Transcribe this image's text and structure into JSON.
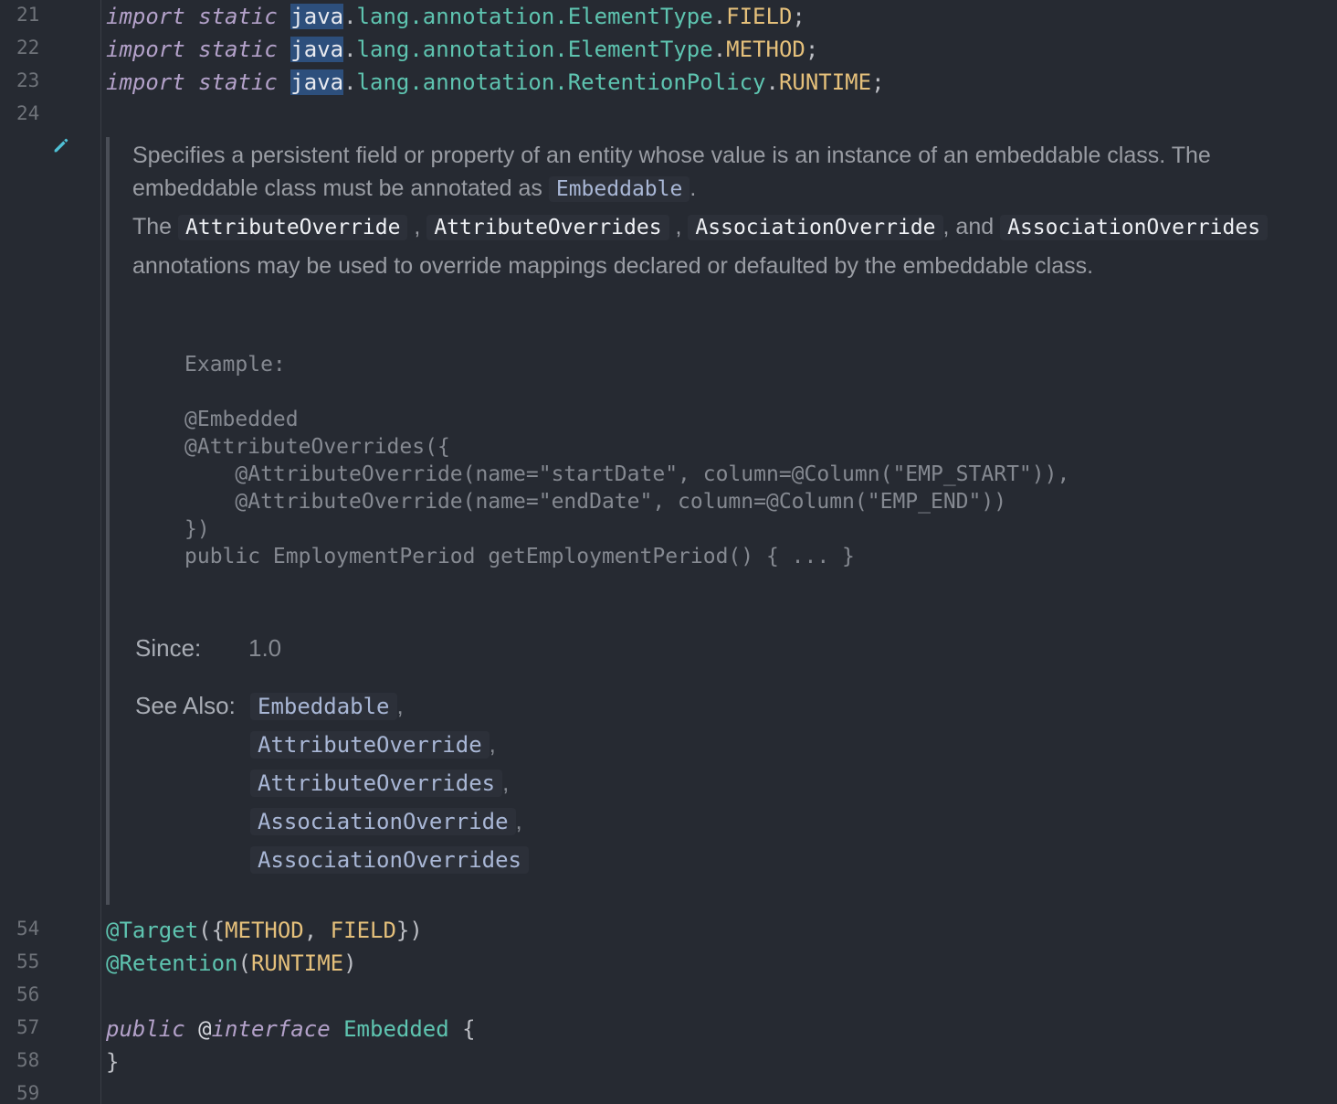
{
  "gutter": {
    "top_lines": [
      "21",
      "22",
      "23",
      "24"
    ],
    "bottom_lines": [
      "54",
      "55",
      "56",
      "57",
      "58",
      "59"
    ]
  },
  "code_top": [
    {
      "kw": "import static",
      "hl": "java",
      "dot": ".",
      "pkg": "lang.annotation.",
      "cls": "ElementType",
      "sep": ".",
      "fld": "FIELD",
      "end": ";"
    },
    {
      "kw": "import static",
      "hl": "java",
      "dot": ".",
      "pkg": "lang.annotation.",
      "cls": "ElementType",
      "sep": ".",
      "fld": "METHOD",
      "end": ";"
    },
    {
      "kw": "import static",
      "hl": "java",
      "dot": ".",
      "pkg": "lang.annotation.",
      "cls": "RetentionPolicy",
      "sep": ".",
      "fld": "RUNTIME",
      "end": ";"
    }
  ],
  "doc": {
    "para1": "Specifies a persistent field or property of an entity whose value is an instance of an embeddable class. The embeddable class must be annotated as",
    "para1_link": "Embeddable",
    "para1_end": ".",
    "para2_start": "The",
    "para2_code1": "AttributeOverride",
    "para2_sep1": ",",
    "para2_code2": "AttributeOverrides",
    "para2_sep2": ",",
    "para2_code3": "AssociationOverride",
    "para2_and": ", and",
    "para2_code4": "AssociationOverrides",
    "para2_end": "annotations may be used to override mappings declared or defaulted by the embeddable class.",
    "example": "Example:\n\n@Embedded\n@AttributeOverrides({\n    @AttributeOverride(name=\"startDate\", column=@Column(\"EMP_START\")),\n    @AttributeOverride(name=\"endDate\", column=@Column(\"EMP_END\"))\n})\npublic EmploymentPeriod getEmploymentPeriod() { ... }",
    "since_label": "Since:",
    "since_value": "1.0",
    "see_also_label": "See Also:",
    "see_also": [
      "Embeddable",
      "AttributeOverride",
      "AttributeOverrides",
      "AssociationOverride",
      "AssociationOverrides"
    ],
    "see_also_sep": ","
  },
  "code_bottom": {
    "l54_anno": "@Target",
    "l54_open": "({",
    "l54_f1": "METHOD",
    "l54_comma": ", ",
    "l54_f2": "FIELD",
    "l54_close": "})",
    "l55_anno": "@Retention",
    "l55_open": "(",
    "l55_f": "RUNTIME",
    "l55_close": ")",
    "l57_kw1": "public",
    "l57_at": "@",
    "l57_kw2": "interface",
    "l57_name": "Embedded",
    "l57_brace": "{",
    "l58_brace": "}"
  },
  "colors": {
    "background": "#262a32",
    "keyword": "#b3a1c9",
    "class": "#5ec4b0",
    "constant": "#e5c07b",
    "selection": "#2d4f7c"
  },
  "icons": {
    "edit": "pencil-icon"
  }
}
